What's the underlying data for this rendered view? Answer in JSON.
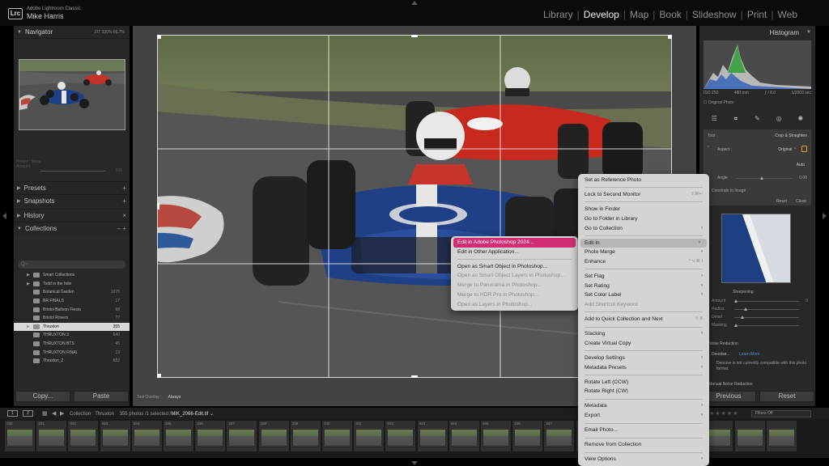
{
  "app": {
    "badge": "Lrc",
    "name": "Adobe Lightroom Classic",
    "user": "Mike Harris"
  },
  "modules": [
    "Library",
    "Develop",
    "Map",
    "Book",
    "Slideshow",
    "Print",
    "Web"
  ],
  "active_module": "Develop",
  "left_panel": {
    "navigator": {
      "title": "Navigator",
      "opts": "FIT  100%  66.7%"
    },
    "ghost_preset": {
      "label1": "Preset : None",
      "label2": "Amount",
      "value": "100"
    },
    "presets": "Presets",
    "snapshots": "Snapshots",
    "history": "History",
    "collections": "Collections",
    "collections_plus_minus": "– +",
    "search_placeholder": "Q~",
    "collection_items": [
      {
        "label": "Smart Collections",
        "count": "",
        "expander": "▶"
      },
      {
        "label": "Todd in the hole",
        "count": "",
        "expander": "▶"
      },
      {
        "label": "Botanical Garden",
        "count": "1075",
        "expander": ""
      },
      {
        "label": "BR FINALS",
        "count": "17",
        "expander": ""
      },
      {
        "label": "Bristol Balloon Fiesta",
        "count": "68",
        "expander": ""
      },
      {
        "label": "Bristol Rovers",
        "count": "77",
        "expander": ""
      },
      {
        "label": "Thruxton",
        "count": "355",
        "expander": "▶",
        "selected": true
      },
      {
        "label": "THRUXTON 3",
        "count": "640",
        "expander": ""
      },
      {
        "label": "THRUXTON BTS",
        "count": "45",
        "expander": ""
      },
      {
        "label": "THRUXTON FINAL",
        "count": "13",
        "expander": ""
      },
      {
        "label": "Thruxton_2",
        "count": "682",
        "expander": ""
      }
    ],
    "copy_button": "Copy...",
    "paste_button": "Paste"
  },
  "toolbar": {
    "label": "Tool Overlay :",
    "value": "Always"
  },
  "right_panel": {
    "histogram_title": "Histogram",
    "hist_info": [
      "ISO 250",
      "480 mm",
      "ƒ / 8.0",
      "1/2000 sec"
    ],
    "original_photo": "Original Photo",
    "crop": {
      "tool_label": "Tool :",
      "tool_value": "Crop & Straighten",
      "aspect_label": "Aspect :",
      "aspect_value": "Original ⌃",
      "auto": "Auto",
      "angle_label": "Angle",
      "angle_value": "0.00",
      "constrain": "Constrain to Image",
      "reset": "Reset",
      "close": "Close"
    },
    "sharpening": {
      "title": "Sharpening",
      "amount": "Amount",
      "amount_value": "0",
      "radius": "Radius",
      "detail": "Detail",
      "masking": "Masking"
    },
    "noise": {
      "title": "Noise Reduction",
      "denoise": "Denoise...",
      "learn_more": "Learn More",
      "message": "Denoise is not currently compatible with this photo format.",
      "manual": "Manual Noise Reduction"
    },
    "previous_button": "Previous",
    "reset_button": "Reset"
  },
  "filmstrip": {
    "page1": "1",
    "page2": "2",
    "breadcrumb_prefix": "Collection : Thruxton",
    "breadcrumb_count": "355 photos /1 selected /",
    "filename": "MIK_2066-Edit.tif ⌄",
    "filter_label": "Filter :",
    "filters_value": "Filters Off",
    "thumb_numbers": [
      "330",
      "331",
      "332",
      "333",
      "334",
      "335",
      "336",
      "337",
      "338",
      "339",
      "340",
      "341",
      "342",
      "343",
      "344",
      "345",
      "346",
      "347",
      "",
      "",
      "",
      "",
      "",
      "",
      ""
    ]
  },
  "submenu_edit_in": [
    {
      "label": "Edit in Adobe Photoshop 2024...",
      "state": "highlight"
    },
    {
      "label": "Edit in Other Application...",
      "state": "normal"
    },
    {
      "sep": true
    },
    {
      "label": "Open as Smart Object in Photoshop...",
      "state": "normal"
    },
    {
      "label": "Open as Smart Object Layers in Photoshop...",
      "state": "disabled"
    },
    {
      "label": "Merge to Panorama in Photoshop...",
      "state": "disabled"
    },
    {
      "label": "Merge to HDR Pro in Photoshop...",
      "state": "disabled"
    },
    {
      "label": "Open as Layers in Photoshop...",
      "state": "disabled"
    }
  ],
  "context_menu": [
    {
      "label": "Set as Reference Photo"
    },
    {
      "sep": true
    },
    {
      "label": "Lock to Second Monitor",
      "shortcut": "⇧⌘↩"
    },
    {
      "sep": true
    },
    {
      "label": "Show in Finder"
    },
    {
      "label": "Go to Folder in Library"
    },
    {
      "label": "Go to Collection",
      "arrow": true
    },
    {
      "sep": true
    },
    {
      "label": "Edit In",
      "arrow": true,
      "active": true
    },
    {
      "label": "Photo Merge",
      "arrow": true
    },
    {
      "label": "Enhance",
      "shortcut": "^⌥⌘ I"
    },
    {
      "sep": true
    },
    {
      "label": "Set Flag",
      "arrow": true
    },
    {
      "label": "Set Rating",
      "arrow": true
    },
    {
      "label": "Set Color Label",
      "arrow": true
    },
    {
      "label": "Add Shortcut Keyword",
      "disabled": true
    },
    {
      "sep": true
    },
    {
      "label": "Add to Quick Collection and Next",
      "shortcut": "⇧ B"
    },
    {
      "sep": true
    },
    {
      "label": "Stacking",
      "arrow": true
    },
    {
      "label": "Create Virtual Copy"
    },
    {
      "sep": true
    },
    {
      "label": "Develop Settings",
      "arrow": true
    },
    {
      "label": "Metadata Presets",
      "arrow": true
    },
    {
      "sep": true
    },
    {
      "label": "Rotate Left (CCW)"
    },
    {
      "label": "Rotate Right (CW)"
    },
    {
      "sep": true
    },
    {
      "label": "Metadata",
      "arrow": true
    },
    {
      "label": "Export",
      "arrow": true
    },
    {
      "sep": true
    },
    {
      "label": "Email Photo..."
    },
    {
      "sep": true
    },
    {
      "label": "Remove from Collection"
    },
    {
      "sep": true
    },
    {
      "label": "View Options",
      "arrow": true
    }
  ],
  "colors": {
    "highlight_pink": "#cf2e73",
    "menu_bg": "#d6d3d3",
    "car_blue": "#1f3f86",
    "car_red": "#c8291f"
  },
  "icons": [
    "lrc-logo",
    "lock-icon",
    "crop-tool-icon",
    "healing-icon",
    "redeye-icon",
    "masking-icon",
    "sliders-icon",
    "grid-view-icon",
    "prev-arrow-icon",
    "next-arrow-icon"
  ]
}
